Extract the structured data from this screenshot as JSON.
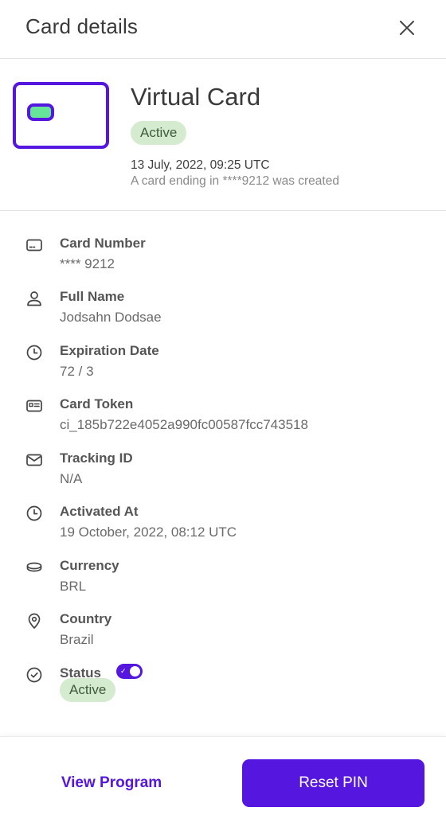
{
  "header": {
    "title": "Card details",
    "close_icon": "close-icon"
  },
  "card": {
    "title": "Virtual Card",
    "status": "Active",
    "event_date": "13 July, 2022, 09:25 UTC",
    "event_description": "A card ending in ****9212 was created",
    "accent_color": "#5516E0",
    "chip_color": "#66E49A"
  },
  "details": {
    "card_number": {
      "label": "Card Number",
      "value": "**** 9212",
      "icon": "credit-card-icon"
    },
    "full_name": {
      "label": "Full Name",
      "value": "Jodsahn Dodsae",
      "icon": "user-icon"
    },
    "expiration_date": {
      "label": "Expiration Date",
      "value": "72 / 3",
      "icon": "clock-icon"
    },
    "card_token": {
      "label": "Card Token",
      "value": "ci_185b722e4052a990fc00587fcc743518",
      "icon": "id-card-icon"
    },
    "tracking_id": {
      "label": "Tracking ID",
      "value": "N/A",
      "icon": "mail-icon"
    },
    "activated_at": {
      "label": "Activated At",
      "value": "19 October, 2022, 08:12 UTC",
      "icon": "clock-icon"
    },
    "currency": {
      "label": "Currency",
      "value": "BRL",
      "icon": "coin-icon"
    },
    "country": {
      "label": "Country",
      "value": "Brazil",
      "icon": "map-pin-icon"
    },
    "status": {
      "label": "Status",
      "value": "Active",
      "toggle_on": true,
      "icon": "check-circle-icon"
    }
  },
  "footer": {
    "view_program_label": "View Program",
    "reset_pin_label": "Reset PIN"
  },
  "colors": {
    "primary": "#5516E0",
    "badge_bg": "#D4EBCF",
    "badge_text": "#3F5A3A",
    "divider": "#E3E3E3"
  }
}
